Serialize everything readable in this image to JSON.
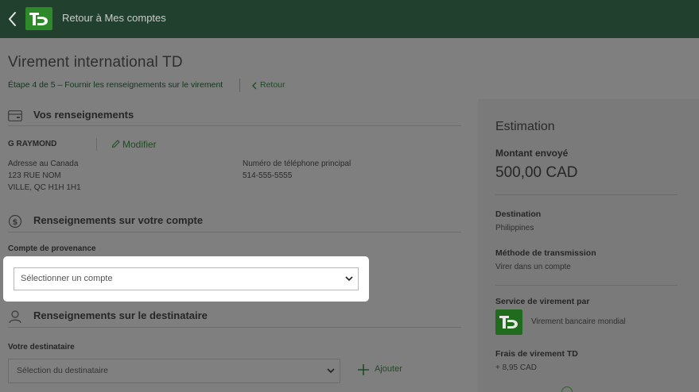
{
  "header": {
    "back_label": "Retour à Mes comptes",
    "logo_text": "TD",
    "bg_color": "#21412e",
    "brand_color": "#2e8a28"
  },
  "page": {
    "title": "Virement international TD",
    "step": "Étape 4 de 5 – Fournir les renseignements sur le virement",
    "retour": "Retour"
  },
  "vos_renseignements": {
    "heading": "Vos renseignements",
    "heading_icon": "card-icon",
    "name": "G RAYMOND",
    "modifier": "Modifier",
    "address_label": "Adresse au Canada",
    "address_line1": "123 RUE NOM",
    "address_line2": "VILLE, QC H1H 1H1",
    "phone_label": "Numéro de téléphone principal",
    "phone_value": "514-555-5555"
  },
  "compte": {
    "heading": "Renseignements sur votre compte",
    "heading_icon": "dollar-coin-icon",
    "field_label": "Compte de provenance",
    "select_placeholder": "Sélectionner un compte"
  },
  "destinataire": {
    "heading": "Renseignements sur le destinataire",
    "heading_icon": "person-icon",
    "field_label": "Votre destinataire",
    "select_placeholder": "Sélection du destinataire",
    "add_label": "Ajouter"
  },
  "estimation": {
    "title": "Estimation",
    "amount_label": "Montant envoyé",
    "amount_value": "500,00 CAD",
    "destination_label": "Destination",
    "destination_value": "Philippines",
    "method_label": "Méthode de transmission",
    "method_value": "Virer dans un compte",
    "service_label": "Service de virement par",
    "service_value": "Virement bancaire mondial",
    "fees_label": "Frais de virement TD",
    "fees_value": "+ 8,95 CAD"
  }
}
